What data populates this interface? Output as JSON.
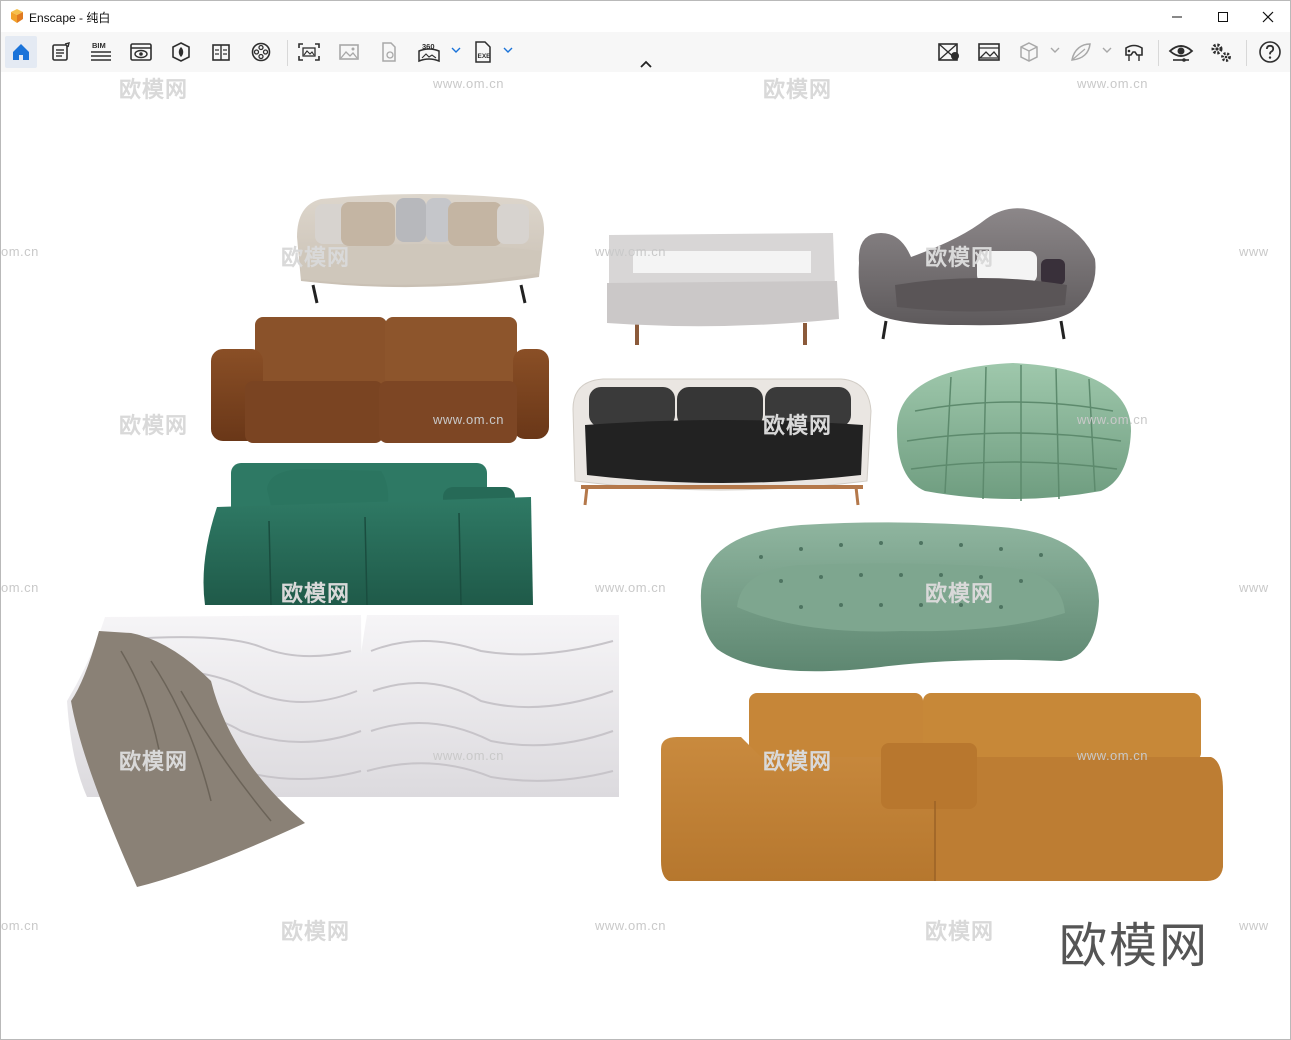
{
  "window": {
    "app_name": "Enscape",
    "title_separator": " - ",
    "scene_name": "纯白"
  },
  "toolbar": {
    "bim_label": "BIM",
    "pano_label": "360",
    "exe_label": "EXE"
  },
  "viewport": {
    "watermark_cn": "欧模网",
    "watermark_url": "www.om.cn",
    "watermark_url_cropped": "om.cn",
    "watermark_url_edge": "www",
    "brand_mark": "欧模网"
  },
  "colors": {
    "accent_blue": "#1a73d9",
    "logo_orange": "#f2a22a",
    "icon_gray": "#2e2e2e",
    "icon_disabled": "#a8a8a8"
  }
}
